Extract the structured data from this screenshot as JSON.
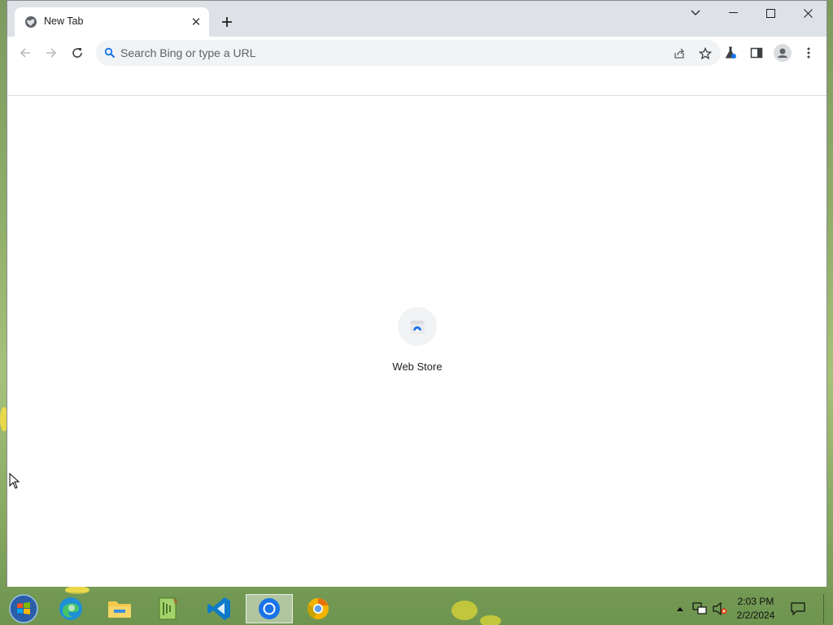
{
  "browser": {
    "tab": {
      "title": "New Tab",
      "favicon": "globe-icon",
      "close_icon": "close-icon"
    },
    "new_tab_icon": "plus-icon",
    "window_controls": [
      "tab-search-chevron-icon",
      "minimize-icon",
      "maximize-icon",
      "close-icon"
    ],
    "toolbar": {
      "back_icon": "arrow-left-icon",
      "forward_icon": "arrow-right-icon",
      "reload_icon": "reload-icon",
      "omnibox": {
        "placeholder": "Search Bing or type a URL",
        "value": ""
      },
      "omnibox_icons": [
        "share-icon",
        "star-icon"
      ],
      "right_icons": [
        "labs-flask-icon",
        "side-panel-icon",
        "profile-icon",
        "more-menu-icon"
      ]
    },
    "new_tab_page": {
      "shortcuts": [
        {
          "label": "Web Store",
          "icon": "web-store-icon"
        }
      ]
    }
  },
  "taskbar": {
    "start_icon": "windows-start-icon",
    "apps": [
      {
        "name": "edge",
        "icon": "edge-icon"
      },
      {
        "name": "file-explorer",
        "icon": "folder-icon"
      },
      {
        "name": "editor",
        "icon": "notepad-plus-icon"
      },
      {
        "name": "vscode",
        "icon": "vscode-icon"
      },
      {
        "name": "chrome",
        "icon": "chrome-icon",
        "active": true
      },
      {
        "name": "chrome-canary",
        "icon": "chrome-canary-icon"
      }
    ],
    "tray": {
      "icons": [
        "show-hidden-icon",
        "network-icon",
        "volume-muted-icon",
        "notification-icon"
      ],
      "time": "2:03 PM",
      "date": "2/2/2024"
    }
  },
  "colors": {
    "tabstrip": "#dee1e6",
    "omnibox": "#f1f3f4",
    "text": "#202124",
    "google_blue": "#1a73e8"
  }
}
